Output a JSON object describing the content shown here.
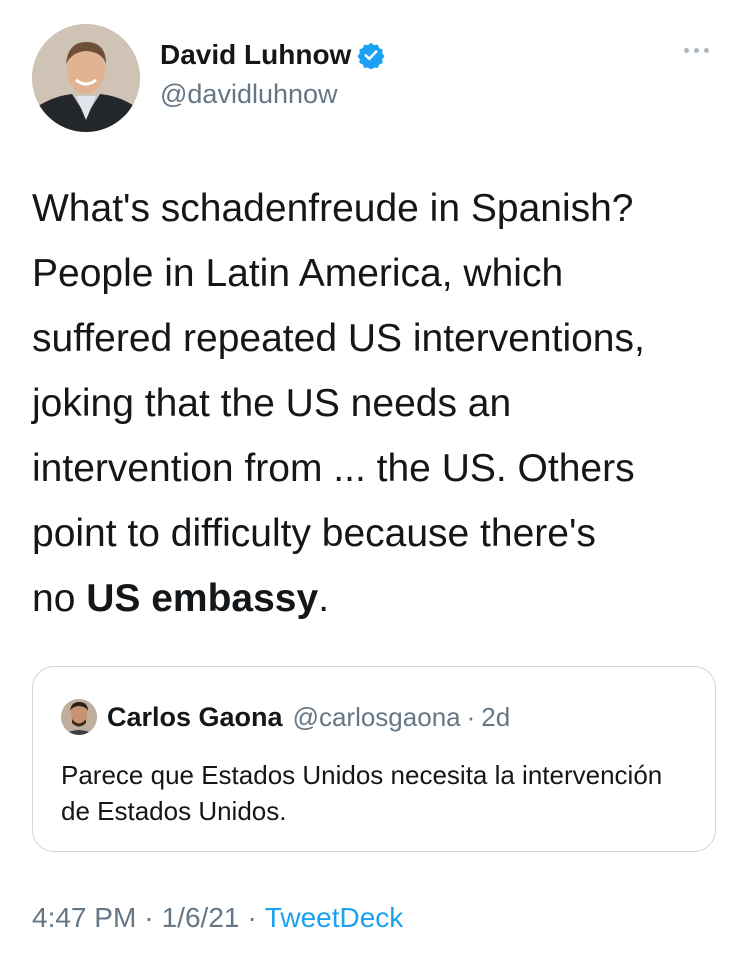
{
  "author": {
    "display_name": "David Luhnow",
    "handle": "@davidluhnow",
    "verified": true
  },
  "icons": {
    "verified": "verified-badge-icon",
    "more": "more-options-icon"
  },
  "tweet": {
    "text_line_1": "What's schadenfreude in Spanish?",
    "text_line_2": "People in Latin America, which",
    "text_line_3": "suffered repeated US interventions,",
    "text_line_4": "joking that the US needs an",
    "text_line_5": "intervention from ... the US. Others",
    "text_line_6": "point to difficulty because there's",
    "text_line_7_prefix": "no ",
    "text_line_7_bold": "US embassy",
    "text_line_7_suffix": "."
  },
  "quoted_tweet": {
    "display_name": "Carlos Gaona",
    "handle": "@carlosgaona",
    "separator": "·",
    "time": "2d",
    "text": "Parece que Estados Unidos necesita la intervención de Estados Unidos."
  },
  "meta": {
    "time": "4:47 PM",
    "separator": "·",
    "date": "1/6/21",
    "source": "TweetDeck"
  },
  "colors": {
    "link": "#1da1f2",
    "secondary_text": "#657786",
    "border": "#ccd6dd"
  }
}
